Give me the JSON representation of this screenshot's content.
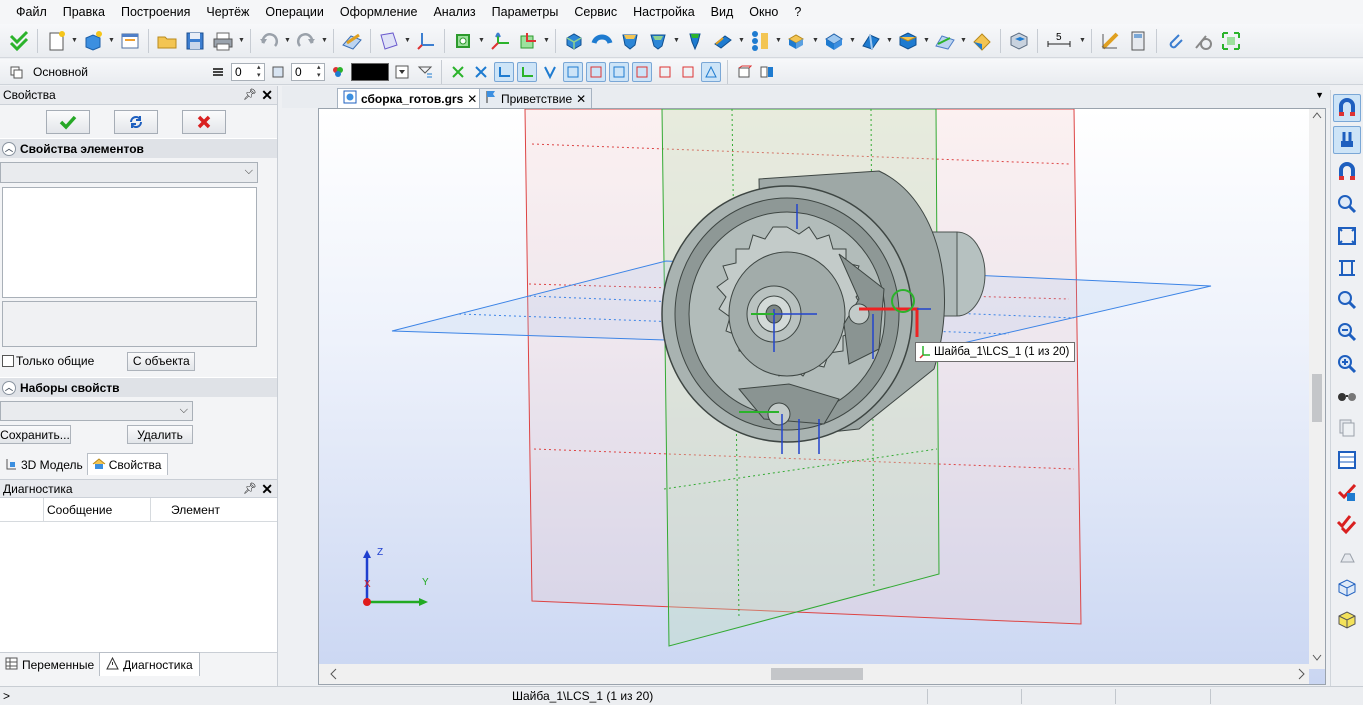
{
  "menu": [
    "Файл",
    "Правка",
    "Построения",
    "Чертёж",
    "Операции",
    "Оформление",
    "Анализ",
    "Параметры",
    "Сервис",
    "Настройка",
    "Вид",
    "Окно",
    "?"
  ],
  "layer": {
    "name": "Основной",
    "value1": "0",
    "value2": "0"
  },
  "properties_panel": {
    "title": "Свойства",
    "section_elements": "Свойства элементов",
    "only_common": "Только общие",
    "from_object": "С объекта",
    "section_sets": "Наборы свойств",
    "save": "Сохранить...",
    "delete": "Удалить",
    "tab_model": "3D Модель",
    "tab_props": "Свойства"
  },
  "diagnostics": {
    "title": "Диагностика",
    "col_message": "Сообщение",
    "col_element": "Элемент"
  },
  "bottom_tabs": {
    "variables": "Переменные",
    "diagnostics": "Диагностика"
  },
  "doc_tabs": [
    {
      "label": "сборка_готов.grs"
    },
    {
      "label": "Приветствие"
    }
  ],
  "tooltip": "Шайба_1\\LCS_1 (1 из 20)",
  "axes": {
    "x": "X",
    "y": "Y",
    "z": "Z"
  },
  "statusbar": {
    "prompt": ">",
    "text": "Шайба_1\\LCS_1 (1 из 20)"
  },
  "colors": {
    "accent": "#2f6fc2",
    "plane_red": "#d44",
    "plane_green": "#3a3",
    "plane_blue": "#3c84e6"
  }
}
